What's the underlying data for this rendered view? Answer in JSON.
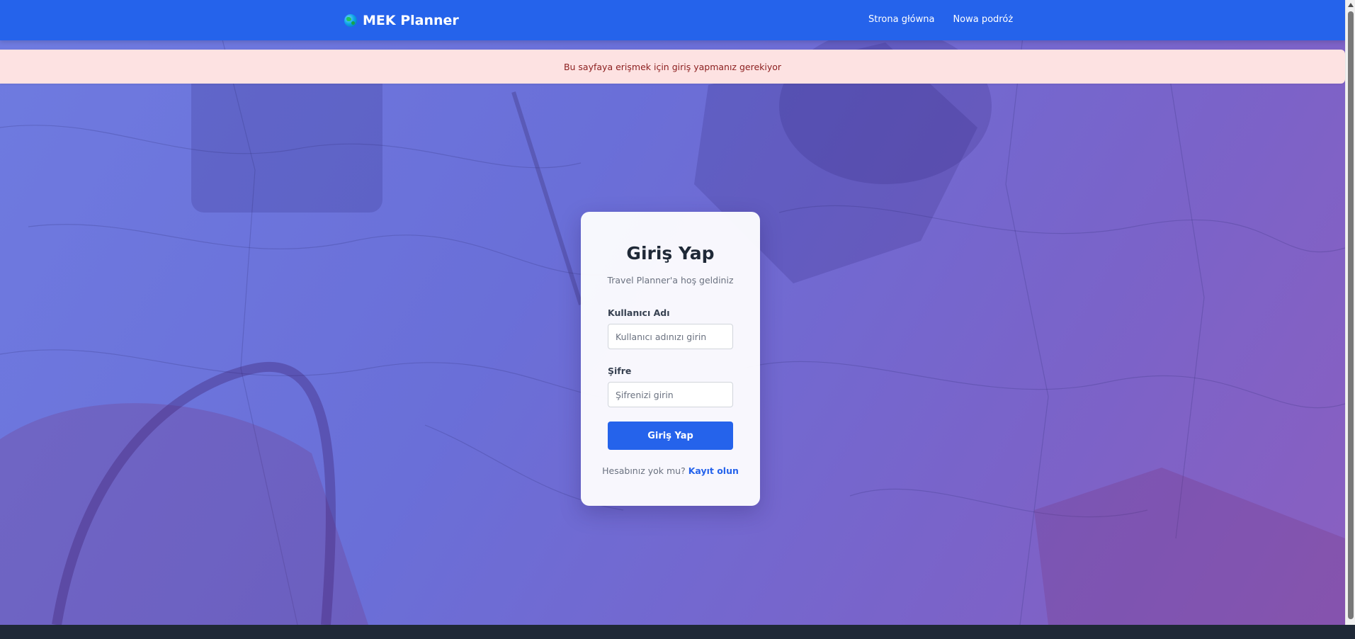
{
  "navbar": {
    "brand": "MEK Planner",
    "links": [
      {
        "label": "Strona główna"
      },
      {
        "label": "Nowa podróż"
      }
    ]
  },
  "alert": {
    "message": "Bu sayfaya erişmek için giriş yapmanız gerekiyor"
  },
  "login": {
    "title": "Giriş Yap",
    "subtitle": "Travel Planner'a hoş geldiniz",
    "username_label": "Kullanıcı Adı",
    "username_placeholder": "Kullanıcı adınızı girin",
    "password_label": "Şifre",
    "password_placeholder": "Şifrenizi girin",
    "submit_label": "Giriş Yap",
    "register_prompt": "Hesabınız yok mu?",
    "register_link": "Kayıt olun"
  },
  "colors": {
    "primary": "#2563eb",
    "alert_bg": "#fde2e2",
    "alert_text": "#8b1e1e",
    "overlay": "#6a6fd8"
  }
}
